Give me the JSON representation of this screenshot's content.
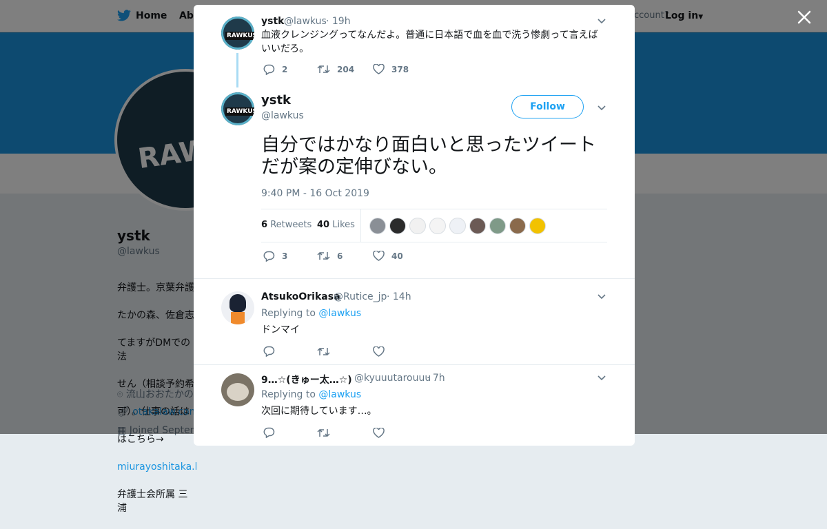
{
  "topbar": {
    "home_label": "Home",
    "about_label": "Abo",
    "account_prompt": "ccount?",
    "login_label": "Log in"
  },
  "profile": {
    "name": "ystk",
    "handle": "@lawkus",
    "avatar_text": "RAWK",
    "bio_lines": [
      "弁護士。京葉弁護",
      "たかの森、佐倉志",
      "てますがDMでの法",
      "せん（相談予約希",
      "可）。仕事の話は",
      "はこちら→"
    ],
    "bio_link": "miurayoshitaka.ha",
    "bio_tail": "弁護士会所属 三浦",
    "location": "流山おおたかの",
    "website": "otakalaw.com",
    "joined": "Joined Septem"
  },
  "parent_tweet": {
    "name": "ystk",
    "handle": "@lawkus",
    "time": "· 19h",
    "text": "血液クレンジングってなんだよ。普通に日本語で血を血で洗う惨劇って言えばいいだろ。",
    "replies": "2",
    "retweets": "204",
    "likes": "378"
  },
  "main_tweet": {
    "name": "ystk",
    "handle": "@lawkus",
    "avatar_text": "RAWKUS",
    "follow_label": "Follow",
    "text": "自分ではかなり面白いと思ったツイートだが案の定伸びない。",
    "timestamp": "9:40 PM - 16 Oct 2019",
    "retweet_count": "6",
    "retweet_label": "Retweets",
    "like_count": "40",
    "like_label": "Likes",
    "replies": "3",
    "retweets": "6",
    "likes": "40",
    "liker_colors": [
      "#8a8f96",
      "#2b2b2b",
      "#f1f1f1",
      "#f4f4f4",
      "#eef1f6",
      "#6b5a55",
      "#7f9a88",
      "#8a6a4c",
      "#f2c200"
    ]
  },
  "replies": [
    {
      "name": "AtsukoOrikasa",
      "handle": "@Rutice_jp",
      "time": "· 14h",
      "replying_label": "Replying to",
      "replying_to": "@lawkus",
      "text": "ドンマイ"
    },
    {
      "name": "9…☆(きゅー太…☆)",
      "handle": "@kyuuutarouuu",
      "time": "· 7h",
      "replying_label": "Replying to",
      "replying_to": "@lawkus",
      "text": "次回に期待しています…。"
    }
  ],
  "colors": {
    "accent": "#1da1f2",
    "banner": "#1b95e0",
    "thread_line": "#a9dbf4"
  }
}
